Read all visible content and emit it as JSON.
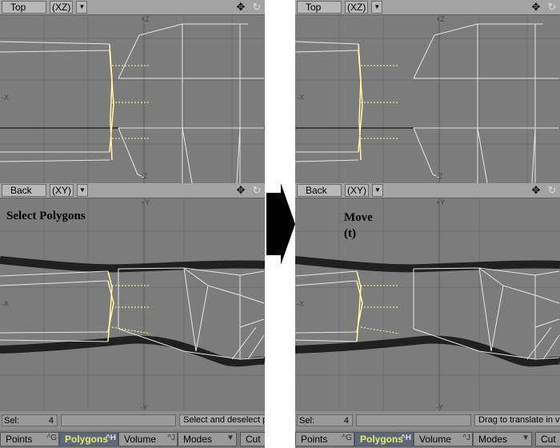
{
  "left": {
    "top_view": {
      "name": "Top",
      "mode": "(XZ)",
      "axis_plus": "+Z",
      "axis_minus": "-Z",
      "axis_x": "-X"
    },
    "back_view": {
      "name": "Back",
      "mode": "(XY)",
      "axis_plus": "+Y",
      "axis_minus": "-Y",
      "axis_x": "-X"
    },
    "annotation": "Select Polygons",
    "status": {
      "sel_label": "Sel:",
      "sel_count": "4",
      "message": "Select and deselect p"
    },
    "bottom": {
      "points": "Points",
      "points_sc": "^G",
      "polygons": "Polygons",
      "polygons_sc": "^H",
      "volume": "Volume",
      "volume_sc": "^J",
      "modes": "Modes",
      "cut": "Cut"
    }
  },
  "right": {
    "top_view": {
      "name": "Top",
      "mode": "(XZ)",
      "axis_plus": "+Z",
      "axis_minus": "-Z",
      "axis_x": "-X"
    },
    "back_view": {
      "name": "Back",
      "mode": "(XY)",
      "axis_plus": "+Y",
      "axis_minus": "-Y",
      "axis_x": "-X"
    },
    "annotation_line1": "Move",
    "annotation_line2": "(t)",
    "status": {
      "sel_label": "Sel:",
      "sel_count": "4",
      "message": "Drag to translate in vie"
    },
    "bottom": {
      "points": "Points",
      "points_sc": "^G",
      "polygons": "Polygons",
      "polygons_sc": "^H",
      "volume": "Volume",
      "volume_sc": "^J",
      "modes": "Modes",
      "cut": "Cut"
    }
  },
  "colors": {
    "selected": "#fffaa0",
    "wire": "#e6e6e6",
    "background": "#7c7c7c",
    "active_mode": "#5a6a7a"
  },
  "icons": [
    "move-view-icon",
    "rotate-view-icon",
    "dropdown-arrow-icon",
    "right-arrow-icon"
  ]
}
